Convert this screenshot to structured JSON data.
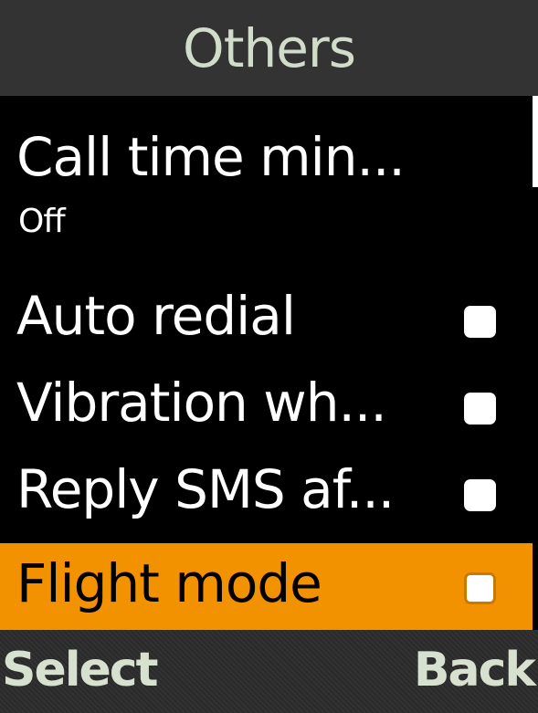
{
  "header": {
    "title": "Others"
  },
  "items": [
    {
      "label": "Call time min...",
      "value": "Off",
      "type": "submenu"
    },
    {
      "label": "Auto redial",
      "type": "checkbox",
      "checked": false
    },
    {
      "label": "Vibration wh...",
      "type": "checkbox",
      "checked": false
    },
    {
      "label": "Reply SMS af...",
      "type": "checkbox",
      "checked": false
    },
    {
      "label": "Flight mode",
      "type": "checkbox",
      "checked": false,
      "selected": true
    }
  ],
  "softkeys": {
    "left": "Select",
    "right": "Back"
  },
  "colors": {
    "header_bg": "#333333",
    "highlight": "#f39200",
    "text": "#ffffff",
    "softkey_text": "#d8e1d0"
  }
}
